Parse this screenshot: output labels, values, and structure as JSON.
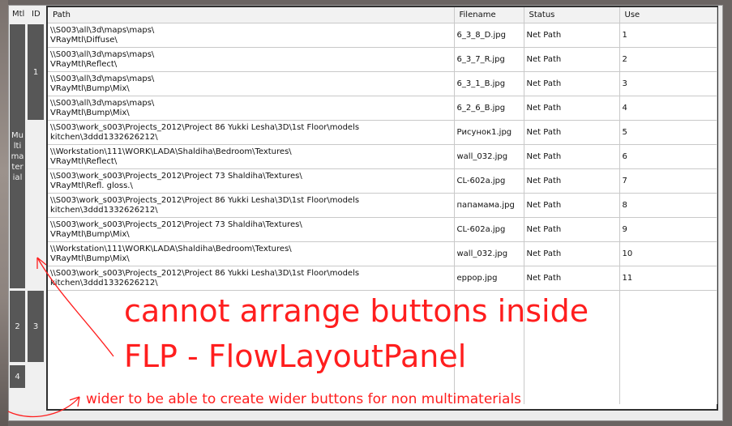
{
  "left_panel": {
    "mtl_header": "Mtl",
    "id_header": "ID",
    "mtl_block_1_lines": [
      "Mu",
      "lti",
      "ma",
      "ter",
      "ial"
    ],
    "id_block_1": "1",
    "mtl_block_2": "2",
    "id_block_2": "3",
    "mtl_block_3": "4"
  },
  "table": {
    "columns": [
      "Path",
      "Filename",
      "Status",
      "Use"
    ],
    "rows": [
      {
        "path1": "\\\\S003\\all\\3d\\maps\\maps\\",
        "path2": "VRayMtl\\Diffuse\\",
        "filename": "6_3_8_D.jpg",
        "status": "Net Path",
        "use": "1"
      },
      {
        "path1": "\\\\S003\\all\\3d\\maps\\maps\\",
        "path2": "VRayMtl\\Reflect\\",
        "filename": "6_3_7_R.jpg",
        "status": "Net Path",
        "use": "2"
      },
      {
        "path1": "\\\\S003\\all\\3d\\maps\\maps\\",
        "path2": "VRayMtl\\Bump\\Mix\\",
        "filename": "6_3_1_B.jpg",
        "status": "Net Path",
        "use": "3"
      },
      {
        "path1": "\\\\S003\\all\\3d\\maps\\maps\\",
        "path2": "VRayMtl\\Bump\\Mix\\",
        "filename": "6_2_6_B.jpg",
        "status": "Net Path",
        "use": "4"
      },
      {
        "path1": "\\\\S003\\work_s003\\Projects_2012\\Project 86 Yukki Lesha\\3D\\1st Floor\\models",
        "path2": "kitchen\\3ddd1332626212\\",
        "filename": "Рисунок1.jpg",
        "status": "Net Path",
        "use": "5"
      },
      {
        "path1": "\\\\Workstation\\111\\WORK\\LADA\\Shaldiha\\Bedroom\\Textures\\",
        "path2": "VRayMtl\\Reflect\\",
        "filename": "wall_032.jpg",
        "status": "Net Path",
        "use": "6"
      },
      {
        "path1": "\\\\S003\\work_s003\\Projects_2012\\Project 73 Shaldiha\\Textures\\",
        "path2": "VRayMtl\\Refl. gloss.\\",
        "filename": "CL-602a.jpg",
        "status": "Net Path",
        "use": "7"
      },
      {
        "path1": "\\\\S003\\work_s003\\Projects_2012\\Project 86 Yukki Lesha\\3D\\1st Floor\\models",
        "path2": "kitchen\\3ddd1332626212\\",
        "filename": "папамама.jpg",
        "status": "Net Path",
        "use": "8"
      },
      {
        "path1": "\\\\S003\\work_s003\\Projects_2012\\Project 73 Shaldiha\\Textures\\",
        "path2": "VRayMtl\\Bump\\Mix\\",
        "filename": "CL-602a.jpg",
        "status": "Net Path",
        "use": "9"
      },
      {
        "path1": "\\\\Workstation\\111\\WORK\\LADA\\Shaldiha\\Bedroom\\Textures\\",
        "path2": "VRayMtl\\Bump\\Mix\\",
        "filename": "wall_032.jpg",
        "status": "Net Path",
        "use": "10"
      },
      {
        "path1": "\\\\S003\\work_s003\\Projects_2012\\Project 86 Yukki Lesha\\3D\\1st Floor\\models",
        "path2": "kitchen\\3ddd1332626212\\",
        "filename": "eppop.jpg",
        "status": "Net Path",
        "use": "11"
      }
    ]
  },
  "annotations": {
    "big_line_1": "cannot arrange buttons inside",
    "big_line_2": "FLP  -    FlowLayoutPanel",
    "small_note": "wider to be able to create wider buttons for non multimaterials",
    "color": "#ff1e1e"
  }
}
